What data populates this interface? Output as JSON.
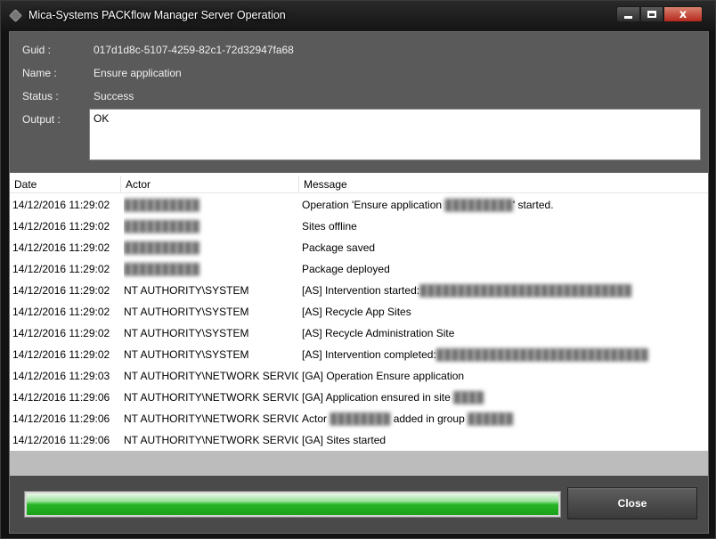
{
  "window": {
    "title": "Mica-Systems PACKflow Manager Server Operation",
    "close_glyph": "x"
  },
  "info": {
    "guid_label": "Guid :",
    "guid_value": "017d1d8c-5107-4259-82c1-72d32947fa68",
    "name_label": "Name :",
    "name_value": "Ensure application",
    "status_label": "Status :",
    "status_value": "Success",
    "output_label": "Output :",
    "output_value": "OK"
  },
  "grid": {
    "columns": {
      "date": "Date",
      "actor": "Actor",
      "message": "Message"
    },
    "rows": [
      {
        "date": "14/12/2016 11:29:02",
        "actor": "",
        "msg": [
          "Operation 'Ensure application ",
          "",
          "' started."
        ]
      },
      {
        "date": "14/12/2016 11:29:02",
        "actor": "",
        "msg": [
          "Sites offline",
          "",
          ""
        ]
      },
      {
        "date": "14/12/2016 11:29:02",
        "actor": "",
        "msg": [
          "Package saved",
          "",
          ""
        ]
      },
      {
        "date": "14/12/2016 11:29:02",
        "actor": "",
        "msg": [
          "Package deployed",
          "",
          ""
        ]
      },
      {
        "date": "14/12/2016 11:29:02",
        "actor": "NT AUTHORITY\\SYSTEM",
        "msg": [
          "[AS] Intervention started:",
          "",
          ""
        ]
      },
      {
        "date": "14/12/2016 11:29:02",
        "actor": "NT AUTHORITY\\SYSTEM",
        "msg": [
          "[AS] Recycle App Sites",
          "",
          ""
        ]
      },
      {
        "date": "14/12/2016 11:29:02",
        "actor": "NT AUTHORITY\\SYSTEM",
        "msg": [
          "[AS] Recycle Administration Site",
          "",
          ""
        ]
      },
      {
        "date": "14/12/2016 11:29:02",
        "actor": "NT AUTHORITY\\SYSTEM",
        "msg": [
          "[AS] Intervention completed:",
          "",
          ""
        ]
      },
      {
        "date": "14/12/2016 11:29:03",
        "actor": "NT AUTHORITY\\NETWORK SERVICE",
        "msg": [
          "[GA] Operation Ensure application",
          "",
          ""
        ]
      },
      {
        "date": "14/12/2016 11:29:06",
        "actor": "NT AUTHORITY\\NETWORK SERVICE",
        "msg": [
          "[GA] Application ensured in site ",
          "",
          ""
        ]
      },
      {
        "date": "14/12/2016 11:29:06",
        "actor": "NT AUTHORITY\\NETWORK SERVICE",
        "msg": [
          "Actor ",
          "",
          " added in group "
        ]
      },
      {
        "date": "14/12/2016 11:29:06",
        "actor": "NT AUTHORITY\\NETWORK SERVICE",
        "msg": [
          "[GA] Sites started",
          "",
          ""
        ]
      }
    ]
  },
  "progress": {
    "fraction": 1.0,
    "color": "#1aa21a"
  },
  "close_button_label": "Close"
}
